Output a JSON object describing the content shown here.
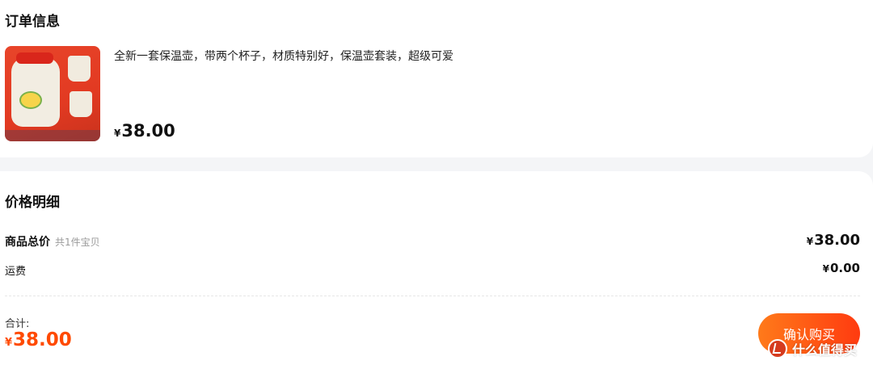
{
  "order_info": {
    "title": "订单信息",
    "product": {
      "image_icon": "product-thumbnail",
      "description": "全新一套保温壶，带两个杯子，材质特别好，保温壶套装，超级可爱",
      "currency": "¥",
      "price": "38.00"
    }
  },
  "price_detail": {
    "title": "价格明细",
    "goods_total": {
      "label": "商品总价",
      "note": "共1件宝贝",
      "currency": "¥",
      "value": "38.00"
    },
    "shipping": {
      "label": "运费",
      "currency": "¥",
      "value": "0.00"
    }
  },
  "footer": {
    "total_label": "合计:",
    "currency": "¥",
    "total_value": "38.00",
    "confirm_label": "确认购买"
  },
  "watermark": {
    "icon": "smzdm-logo-icon",
    "text": "什么值得买"
  },
  "colors": {
    "accent": "#ff4a00",
    "button_start": "#ff7a1a",
    "button_end": "#ff3b10",
    "page_bg": "#f4f5f7"
  }
}
